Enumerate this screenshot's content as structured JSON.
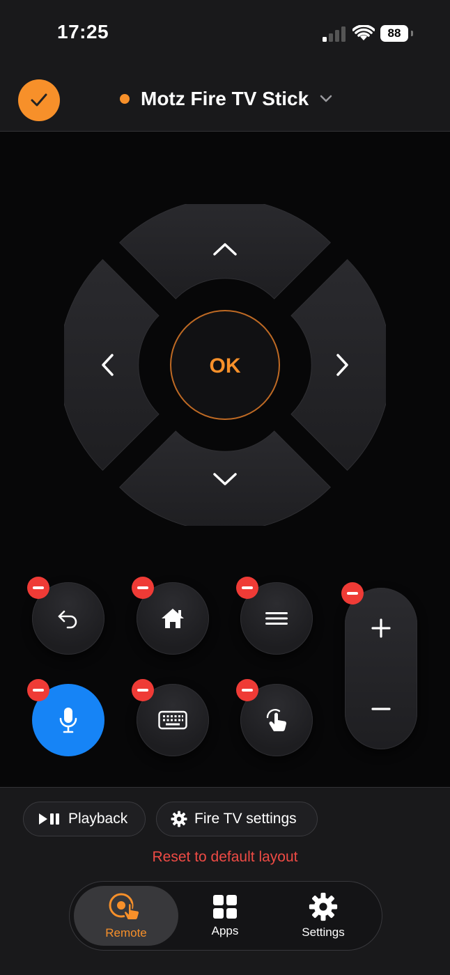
{
  "status_bar": {
    "time": "17:25",
    "battery_level": "88"
  },
  "header": {
    "confirm_icon": "checkmark-icon",
    "device_name": "Motz Fire TV Stick",
    "connection_status_color": "#f7902a"
  },
  "dpad": {
    "ok_label": "OK"
  },
  "buttons": [
    {
      "name": "back",
      "icon": "back-arrow-icon",
      "removable": true
    },
    {
      "name": "home",
      "icon": "home-icon",
      "removable": true
    },
    {
      "name": "menu",
      "icon": "menu-icon",
      "removable": true
    },
    {
      "name": "microphone",
      "icon": "microphone-icon",
      "removable": true
    },
    {
      "name": "keyboard",
      "icon": "keyboard-icon",
      "removable": true
    },
    {
      "name": "touchpad",
      "icon": "tap-gesture-icon",
      "removable": true
    }
  ],
  "volume": {
    "up_symbol": "+",
    "down_symbol": "−"
  },
  "shortcuts": {
    "playback_label": "Playback",
    "fire_tv_settings_label": "Fire TV settings"
  },
  "reset_label": "Reset to default layout",
  "tabs": [
    {
      "label": "Remote",
      "icon": "remote-icon",
      "active": true
    },
    {
      "label": "Apps",
      "icon": "apps-grid-icon",
      "active": false
    },
    {
      "label": "Settings",
      "icon": "gear-icon",
      "active": false
    }
  ],
  "colors": {
    "accent": "#f7902a",
    "mic_blue": "#1684f6",
    "remove_red": "#ef3b36",
    "reset_red": "#ef4b45"
  }
}
